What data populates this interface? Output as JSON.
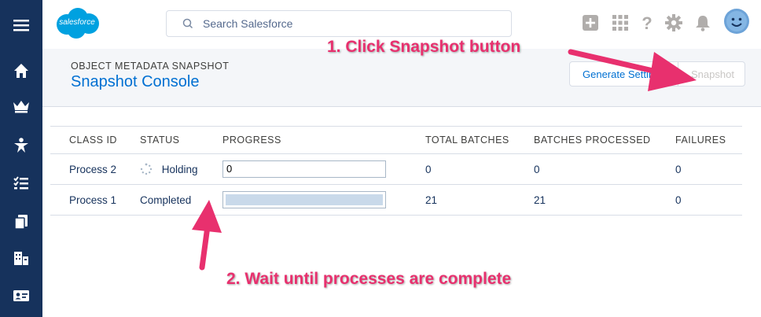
{
  "topbar": {
    "logo_text": "salesforce",
    "search_placeholder": "Search Salesforce"
  },
  "header": {
    "eyebrow": "OBJECT METADATA SNAPSHOT",
    "title": "Snapshot Console",
    "generate_settings_label": "Generate Settings",
    "snapshot_label": "Snapshot"
  },
  "table": {
    "headers": [
      "CLASS ID",
      "STATUS",
      "PROGRESS",
      "TOTAL BATCHES",
      "BATCHES PROCESSED",
      "FAILURES"
    ],
    "rows": [
      {
        "class_id": "Process 2",
        "status": "Holding",
        "progress": 0,
        "progress_text": "0",
        "total_batches": "0",
        "batches_processed": "0",
        "failures": "0"
      },
      {
        "class_id": "Process 1",
        "status": "Completed",
        "progress": 1.0,
        "progress_text": "",
        "total_batches": "21",
        "batches_processed": "21",
        "failures": "0"
      }
    ]
  },
  "annotations": {
    "step1": "1. Click Snapshot button",
    "step2": "2. Wait until processes are complete"
  },
  "colors": {
    "accent": "#0070d2",
    "rail": "#16325c",
    "annotation": "#e8306e",
    "logo": "#00a1e0"
  }
}
